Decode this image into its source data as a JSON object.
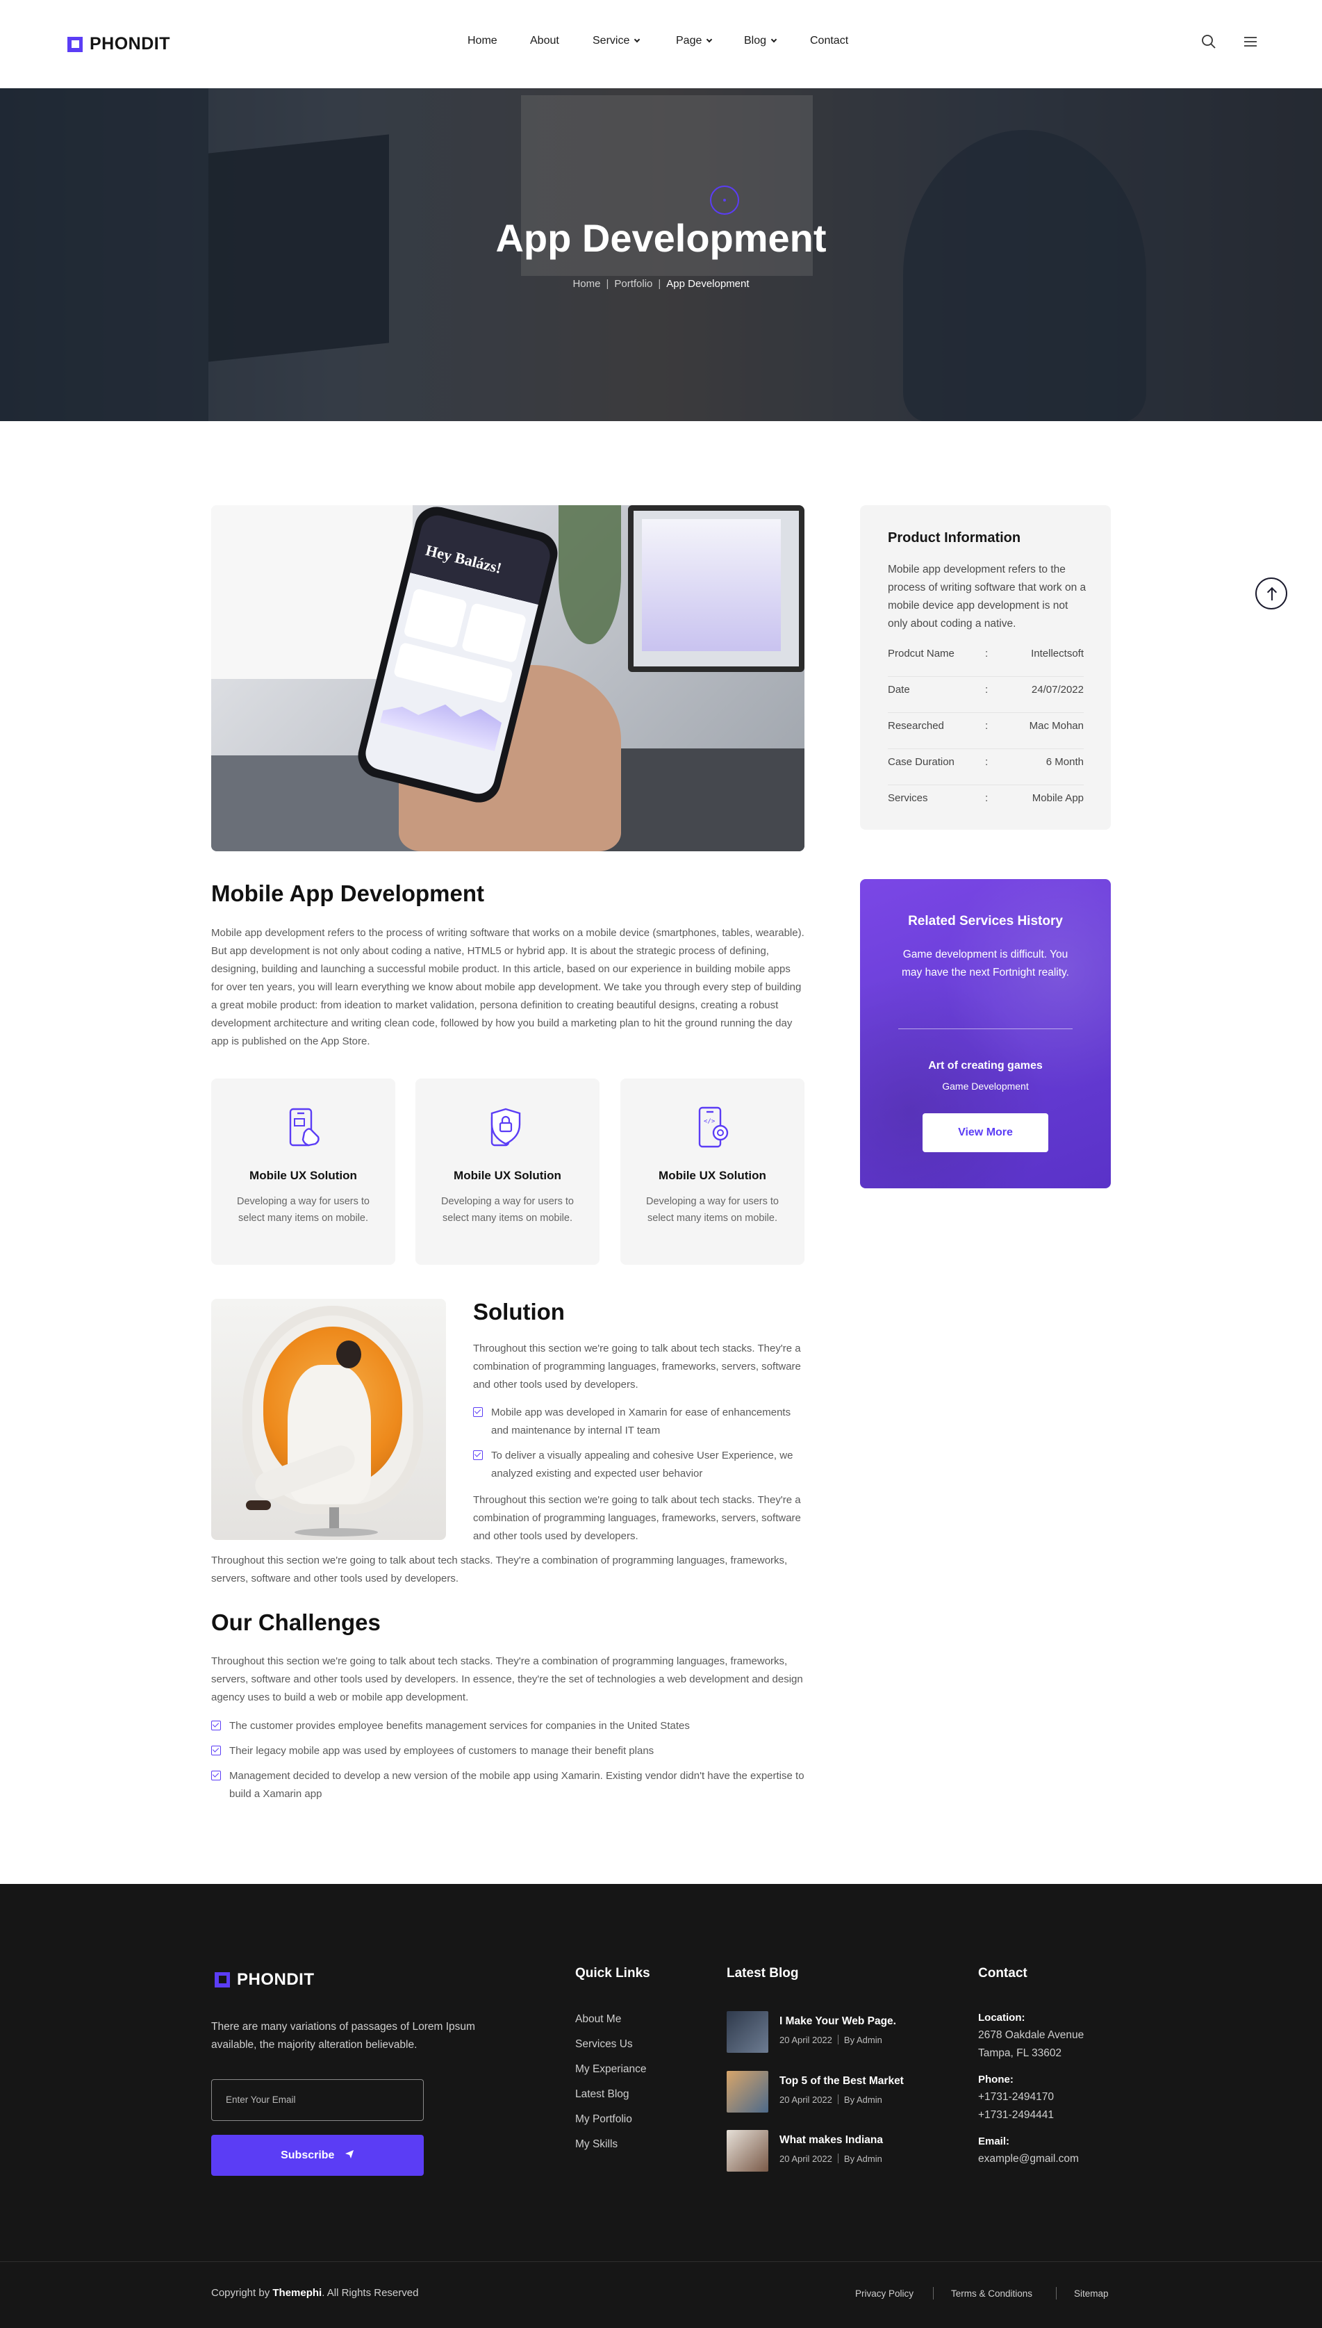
{
  "brand": {
    "name": "PHONDIT",
    "accent": "#5b3df5"
  },
  "nav": {
    "items": [
      {
        "label": "Home",
        "has_dropdown": false
      },
      {
        "label": "About",
        "has_dropdown": false
      },
      {
        "label": "Service",
        "has_dropdown": true
      },
      {
        "label": "Page",
        "has_dropdown": true
      },
      {
        "label": "Blog",
        "has_dropdown": true
      },
      {
        "label": "Contact",
        "has_dropdown": false
      }
    ],
    "icons": [
      "search-icon",
      "menu-icon"
    ]
  },
  "hero": {
    "title": "App Development",
    "breadcrumb": [
      "Home",
      "Portfolio",
      "App Development"
    ],
    "phone_screen_text": "Hey Balázs!"
  },
  "product_info": {
    "title": "Product Information",
    "description": "Mobile app development refers to the process of writing software that work on a mobile device app development is not only about coding a native.",
    "rows": [
      {
        "label": "Prodcut Name",
        "value": "Intellectsoft"
      },
      {
        "label": "Date",
        "value": "24/07/2022"
      },
      {
        "label": "Researched",
        "value": "Mac Mohan"
      },
      {
        "label": "Case Duration",
        "value": "6 Month"
      },
      {
        "label": "Services",
        "value": "Mobile App"
      }
    ],
    "separator": ":"
  },
  "main": {
    "heading": "Mobile App Development",
    "paragraph": "Mobile app development refers to the process of writing software that works on a mobile device (smartphones, tables, wearable). But app development is not only about coding a native, HTML5 or hybrid app. It is about the strategic process of defining, designing, building and launching a successful mobile product. In this article, based on our experience in building mobile apps for over ten years, you will learn everything we know about mobile app development. We take you through every step of building a great mobile product: from ideation to market validation, persona definition to creating beautiful designs, creating a robust development architecture and writing clean code, followed by how you build a marketing plan to hit the ground running the day app is published on the App Store.",
    "features": [
      {
        "icon": "mobile-touch-icon",
        "title": "Mobile UX Solution",
        "desc": "Developing a way for users to select many items on mobile."
      },
      {
        "icon": "mobile-shield-icon",
        "title": "Mobile UX Solution",
        "desc": "Developing a way for users to select many items on mobile."
      },
      {
        "icon": "mobile-gear-icon",
        "title": "Mobile UX Solution",
        "desc": "Developing a way for users to select many items on mobile."
      }
    ]
  },
  "solution": {
    "heading": "Solution",
    "para1": "Throughout this section we're going to talk about tech stacks. They're a combination of programming languages, frameworks, servers, software and other tools used by developers.",
    "checks": [
      "Mobile app was developed in Xamarin for ease of enhancements and maintenance by internal IT team",
      "To deliver a visually appealing and cohesive User Experience, we analyzed existing and expected user behavior"
    ],
    "para2": "Throughout this section we're going to talk about tech stacks. They're a combination of programming languages, frameworks, servers, software and other tools used by developers.",
    "para3": "Throughout this section we're going to talk about tech stacks. They're a combination of programming languages, frameworks, servers, software and other tools used by developers."
  },
  "challenges": {
    "heading": "Our Challenges",
    "paragraph": "Throughout this section we're going to talk about tech stacks. They're a combination of programming languages, frameworks, servers, software and other tools used by developers. In essence, they're the set of technologies a web development and design agency uses to build a web or mobile app development.",
    "checks": [
      "The customer provides employee benefits management services for companies in the United States",
      "Their legacy mobile app was used by employees of customers to manage their benefit plans",
      "Management decided to develop a new version of the mobile app using Xamarin. Existing vendor didn't have the expertise to build a Xamarin app"
    ]
  },
  "related": {
    "title": "Related Services History",
    "desc": "Game development is difficult. You may have the next Fortnight reality.",
    "sub_title": "Art of creating games",
    "sub_desc": "Game Development",
    "button": "View More"
  },
  "footer": {
    "desc": "There are many variations of passages of Lorem Ipsum available, the majority alteration believable.",
    "email_placeholder": "Enter Your Email",
    "subscribe": "Subscribe",
    "quick_links_title": "Quick Links",
    "quick_links": [
      "About Me",
      "Services Us",
      "My Experiance",
      "Latest Blog",
      "My Portfolio",
      "My Skills"
    ],
    "blog_title": "Latest Blog",
    "blogs": [
      {
        "title": "I Make Your Web Page.",
        "date": "20 April 2022",
        "author": "By Admin"
      },
      {
        "title": "Top 5 of the Best Market",
        "date": "20 April 2022",
        "author": "By Admin"
      },
      {
        "title": "What makes Indiana",
        "date": "20 April 2022",
        "author": "By Admin"
      }
    ],
    "contact_title": "Contact",
    "location_label": "Location:",
    "location_lines": [
      "2678 Oakdale Avenue",
      "Tampa, FL 33602"
    ],
    "phone_label": "Phone:",
    "phones": [
      "+1731-2494170",
      "+1731-2494441"
    ],
    "email_label": "Email:",
    "email": "example@gmail.com",
    "copyright_prefix": "Copyright by ",
    "copyright_brand": "Themephi",
    "copyright_suffix": ". All Rights Reserved",
    "legal": [
      "Privacy Policy",
      "Terms & Conditions",
      "Sitemap"
    ]
  }
}
